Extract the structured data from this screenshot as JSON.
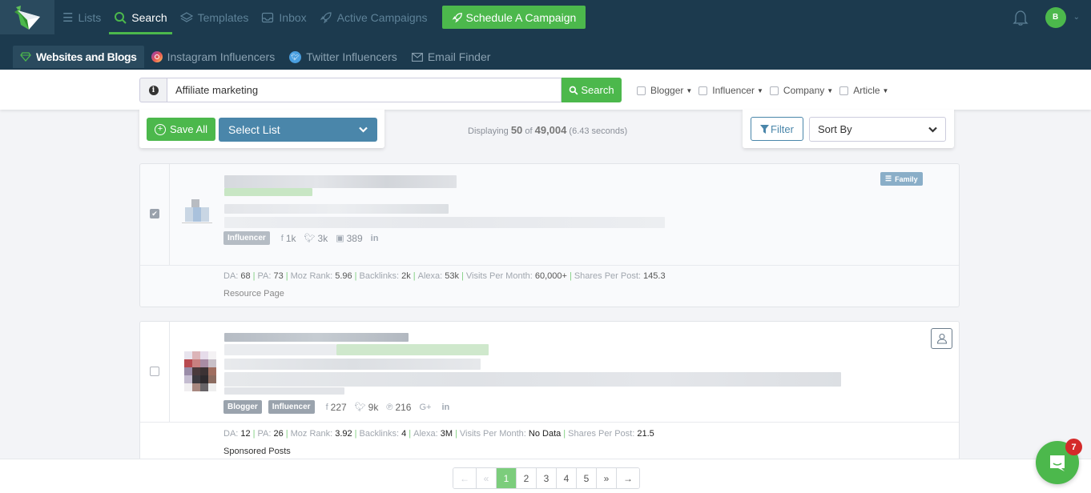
{
  "topnav": {
    "items": [
      {
        "label": "Lists",
        "icon": "list-icon",
        "active": false
      },
      {
        "label": "Search",
        "icon": "search-icon",
        "active": true
      },
      {
        "label": "Templates",
        "icon": "layers-icon",
        "active": false
      },
      {
        "label": "Inbox",
        "icon": "inbox-icon",
        "active": false
      },
      {
        "label": "Active Campaigns",
        "icon": "rocket-icon",
        "active": false
      }
    ],
    "schedule_label": "Schedule A Campaign",
    "user_initial": "B"
  },
  "subnav": {
    "items": [
      {
        "label": "Websites and Blogs",
        "icon": "diamond-icon",
        "active": true
      },
      {
        "label": "Instagram Influencers",
        "icon": "instagram-icon",
        "active": false
      },
      {
        "label": "Twitter Influencers",
        "icon": "twitter-icon",
        "active": false
      },
      {
        "label": "Email Finder",
        "icon": "envelope-icon",
        "active": false
      }
    ]
  },
  "search": {
    "value": "Affiliate marketing",
    "button_label": "Search",
    "type_filters": [
      {
        "label": "Blogger",
        "checked": false
      },
      {
        "label": "Influencer",
        "checked": false
      },
      {
        "label": "Company",
        "checked": false
      },
      {
        "label": "Article",
        "checked": false
      }
    ]
  },
  "toolbar": {
    "save_all_label": "Save All",
    "select_list_label": "Select List",
    "filter_label": "Filter",
    "sort_by_label": "Sort By"
  },
  "results_summary": {
    "prefix": "Displaying",
    "shown": "50",
    "of_label": "of",
    "total": "49,004",
    "time": "(6.43 seconds)"
  },
  "results": [
    {
      "selected": true,
      "tags": [
        "Influencer"
      ],
      "social": [
        {
          "icon": "facebook-icon",
          "value": "1k"
        },
        {
          "icon": "twitter-icon",
          "value": "3k"
        },
        {
          "icon": "youtube-icon",
          "value": "389"
        },
        {
          "icon": "linkedin-icon",
          "value": ""
        }
      ],
      "stats": [
        {
          "label": "DA:",
          "value": "68"
        },
        {
          "label": "PA:",
          "value": "73"
        },
        {
          "label": "Moz Rank:",
          "value": "5.96"
        },
        {
          "label": "Backlinks:",
          "value": "2k"
        },
        {
          "label": "Alexa:",
          "value": "53k"
        },
        {
          "label": "Visits Per Month:",
          "value": "60,000+"
        },
        {
          "label": "Shares Per Post:",
          "value": "145.3"
        }
      ],
      "category": "Resource Page",
      "list_badge": "Family"
    },
    {
      "selected": false,
      "tags": [
        "Blogger",
        "Influencer"
      ],
      "social": [
        {
          "icon": "facebook-icon",
          "value": "227"
        },
        {
          "icon": "twitter-icon",
          "value": "9k"
        },
        {
          "icon": "pinterest-icon",
          "value": "216"
        },
        {
          "icon": "google-plus-icon",
          "value": ""
        },
        {
          "icon": "linkedin-icon",
          "value": ""
        }
      ],
      "stats": [
        {
          "label": "DA:",
          "value": "12"
        },
        {
          "label": "PA:",
          "value": "26"
        },
        {
          "label": "Moz Rank:",
          "value": "3.92"
        },
        {
          "label": "Backlinks:",
          "value": "4"
        },
        {
          "label": "Alexa:",
          "value": "3M"
        },
        {
          "label": "Visits Per Month:",
          "value": "No Data"
        },
        {
          "label": "Shares Per Post:",
          "value": "21.5"
        }
      ],
      "category": "Sponsored Posts"
    }
  ],
  "pagination": {
    "items": [
      {
        "label": "←",
        "state": "disabled"
      },
      {
        "label": "«",
        "state": "disabled"
      },
      {
        "label": "1",
        "state": "active"
      },
      {
        "label": "2",
        "state": "normal"
      },
      {
        "label": "3",
        "state": "normal"
      },
      {
        "label": "4",
        "state": "normal"
      },
      {
        "label": "5",
        "state": "normal"
      },
      {
        "label": "»",
        "state": "normal"
      },
      {
        "label": "→",
        "state": "normal"
      }
    ]
  },
  "chat": {
    "unread": "7"
  },
  "colors": {
    "nav_bg": "#1c3a4e",
    "accent_green": "#4cb84c",
    "select_blue": "#4a86aa",
    "badge_red": "#d42a2a"
  }
}
